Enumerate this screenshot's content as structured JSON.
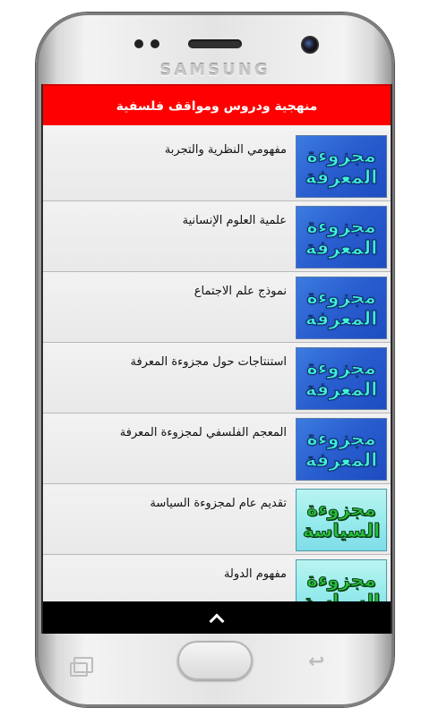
{
  "device": {
    "brand": "SAMSUNG"
  },
  "app": {
    "title": "منهجية ودروس ومواقف فلسفية"
  },
  "lessons": [
    {
      "title": "مفهومي النظرية والتجربة",
      "thumb_line1": "مجزوءة",
      "thumb_line2": "المعرفة",
      "thumb_style": "knowledge"
    },
    {
      "title": "علمية العلوم الإنسانية",
      "thumb_line1": "مجزوءة",
      "thumb_line2": "المعرفة",
      "thumb_style": "knowledge"
    },
    {
      "title": "نموذج علم الاجتماع",
      "thumb_line1": "مجزوءة",
      "thumb_line2": "المعرفة",
      "thumb_style": "knowledge"
    },
    {
      "title": "استنتاجات حول مجزوءة المعرفة",
      "thumb_line1": "مجزوءة",
      "thumb_line2": "المعرفة",
      "thumb_style": "knowledge"
    },
    {
      "title": "المعجم الفلسفي لمجزوءة المعرفة",
      "thumb_line1": "مجزوءة",
      "thumb_line2": "المعرفة",
      "thumb_style": "knowledge"
    },
    {
      "title": "تقديم عام لمجزوءة السياسة",
      "thumb_line1": "مجزوءة",
      "thumb_line2": "السياسة",
      "thumb_style": "politics"
    },
    {
      "title": "مفهوم الدولة",
      "thumb_line1": "مجزوءة",
      "thumb_line2": "السياسة",
      "thumb_style": "politics"
    }
  ],
  "colors": {
    "header": "#ff0000",
    "bottom_bar": "#000000"
  },
  "icons": {
    "scroll_up": "chevron-up-icon",
    "back": "back-icon",
    "recent": "recent-apps-icon"
  }
}
